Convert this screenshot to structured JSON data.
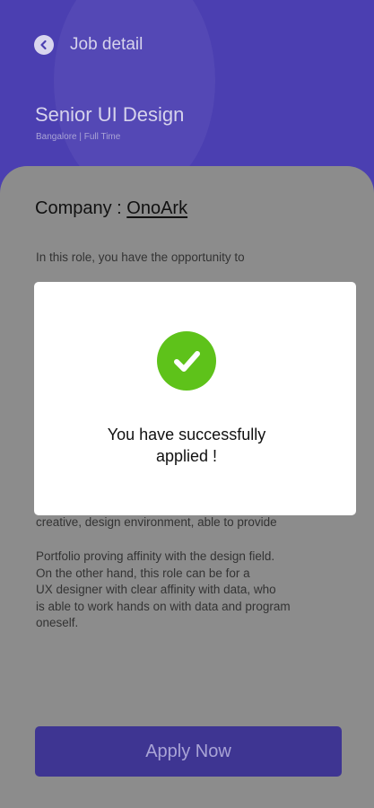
{
  "header": {
    "nav_title": "Job detail",
    "job_title": "Senior UI Design",
    "job_meta": "Bangalore | Full Time"
  },
  "content": {
    "company_label": "Company : ",
    "company_name": "OnoArk",
    "description_line1": "In this role, you have the opportunity to",
    "description_line2": "creative, design environment, able to provide",
    "description_paragraph2": "Portfolio proving affinity with the design field.\nOn the other hand, this role can be for a\nUX designer with clear affinity with data, who\nis able to work hands on with data and program\noneself."
  },
  "apply_button": {
    "label": "Apply Now"
  },
  "modal": {
    "message": "You have successfully\napplied !",
    "icon": "check-circle-icon"
  },
  "colors": {
    "primary": "#4b3fb1",
    "success": "#5ec21a",
    "overlay_bg": "#8c8c8c"
  }
}
